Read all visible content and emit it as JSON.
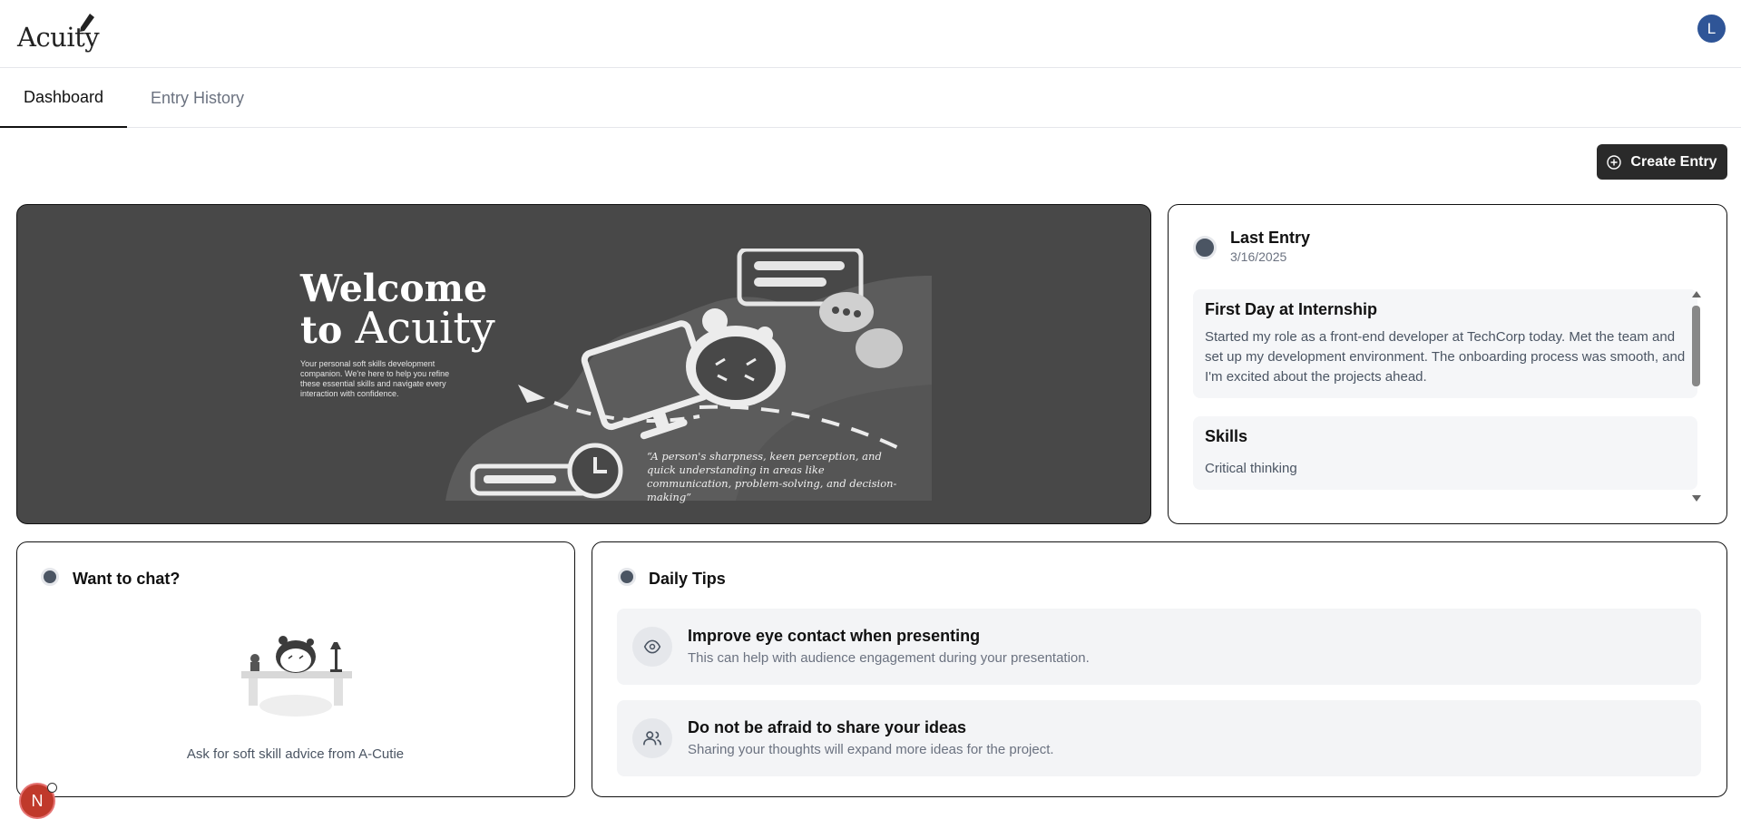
{
  "header": {
    "logo_text": "Acuity",
    "avatar_initial": "L"
  },
  "tabs": [
    {
      "label": "Dashboard",
      "active": true
    },
    {
      "label": "Entry History",
      "active": false
    }
  ],
  "toolbar": {
    "create_entry_label": "Create Entry"
  },
  "hero": {
    "title_line1": "Welcome",
    "title_to": "to",
    "title_brand": "Acuity",
    "description": "Your personal soft skills development companion. We're here to help you refine these essential skills and navigate every interaction with confidence.",
    "quote": "“A person's sharpness, keen perception, and quick understanding in areas like communication, problem-solving, and decision-making”"
  },
  "last_entry": {
    "title": "Last Entry",
    "date": "3/16/2025",
    "entry_title": "First Day at Internship",
    "entry_body": "Started my role as a front-end developer at TechCorp today. Met the team and set up my development environment. The onboarding process was smooth, and I'm excited about the projects ahead.",
    "skills_heading": "Skills",
    "skills": [
      "Critical thinking"
    ]
  },
  "chat": {
    "title": "Want to chat?",
    "caption": "Ask for soft skill advice from A-Cutie"
  },
  "tips": {
    "title": "Daily Tips",
    "items": [
      {
        "icon": "eye-icon",
        "title": "Improve eye contact when presenting",
        "description": "This can help with audience engagement during your presentation."
      },
      {
        "icon": "users-icon",
        "title": "Do not be afraid to share your ideas",
        "description": "Sharing your thoughts will expand more ideas for the project."
      }
    ]
  },
  "floating": {
    "badge_letter": "N"
  },
  "colors": {
    "avatar": "#2f5597",
    "hero_bg": "#484848",
    "button_bg": "#2a2a2a",
    "floating_badge": "#c0392b"
  }
}
